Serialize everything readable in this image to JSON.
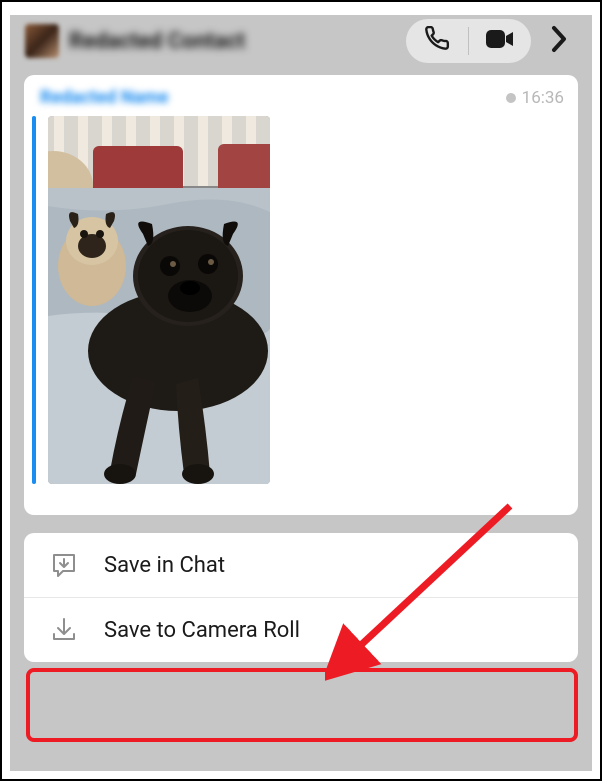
{
  "header": {
    "contact_name": "Redacted Contact",
    "icons": {
      "voice": "phone-icon",
      "video": "video-icon",
      "chevron": "chevron-right-icon"
    }
  },
  "chat": {
    "sender_name": "Redacted Name",
    "timestamp": "16:36"
  },
  "menu": {
    "items": [
      {
        "label": "Save in Chat",
        "icon": "save-chat-icon"
      },
      {
        "label": "Save to Camera Roll",
        "icon": "download-icon"
      }
    ]
  }
}
